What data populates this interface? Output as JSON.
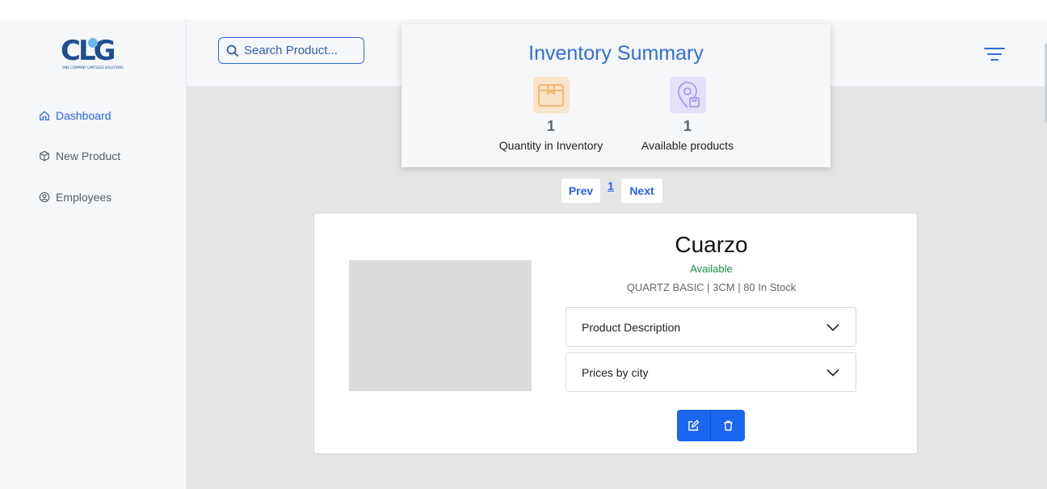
{
  "brand": {
    "logo_text": "CLG",
    "logo_tagline": "ONE COMPANY LIMITLESS SOLUTIONS",
    "primary_color": "#2563eb"
  },
  "sidebar": {
    "items": [
      {
        "label": "Dashboard",
        "icon": "home-icon",
        "active": true
      },
      {
        "label": "New Product",
        "icon": "box-icon",
        "active": false
      },
      {
        "label": "Employees",
        "icon": "user-circle-icon",
        "active": false
      }
    ]
  },
  "header": {
    "search_placeholder": "Search Product...",
    "filter_icon": "filter-icon"
  },
  "summary": {
    "title": "Inventory Summary",
    "stats": [
      {
        "value": "1",
        "label": "Quantity in Inventory",
        "icon": "package-icon",
        "color": "#f3b26b"
      },
      {
        "value": "1",
        "label": "Available products",
        "icon": "location-box-icon",
        "color": "#a59bf0"
      }
    ]
  },
  "pagination": {
    "prev_label": "Prev",
    "current_page": "1",
    "next_label": "Next"
  },
  "product": {
    "name": "Cuarzo",
    "status": "Available",
    "specs": "QUARTZ BASIC | 3CM | 80 In Stock",
    "accordions": [
      {
        "label": "Product Description"
      },
      {
        "label": "Prices by city"
      }
    ],
    "actions": [
      {
        "icon": "edit-icon"
      },
      {
        "icon": "trash-icon"
      }
    ]
  }
}
